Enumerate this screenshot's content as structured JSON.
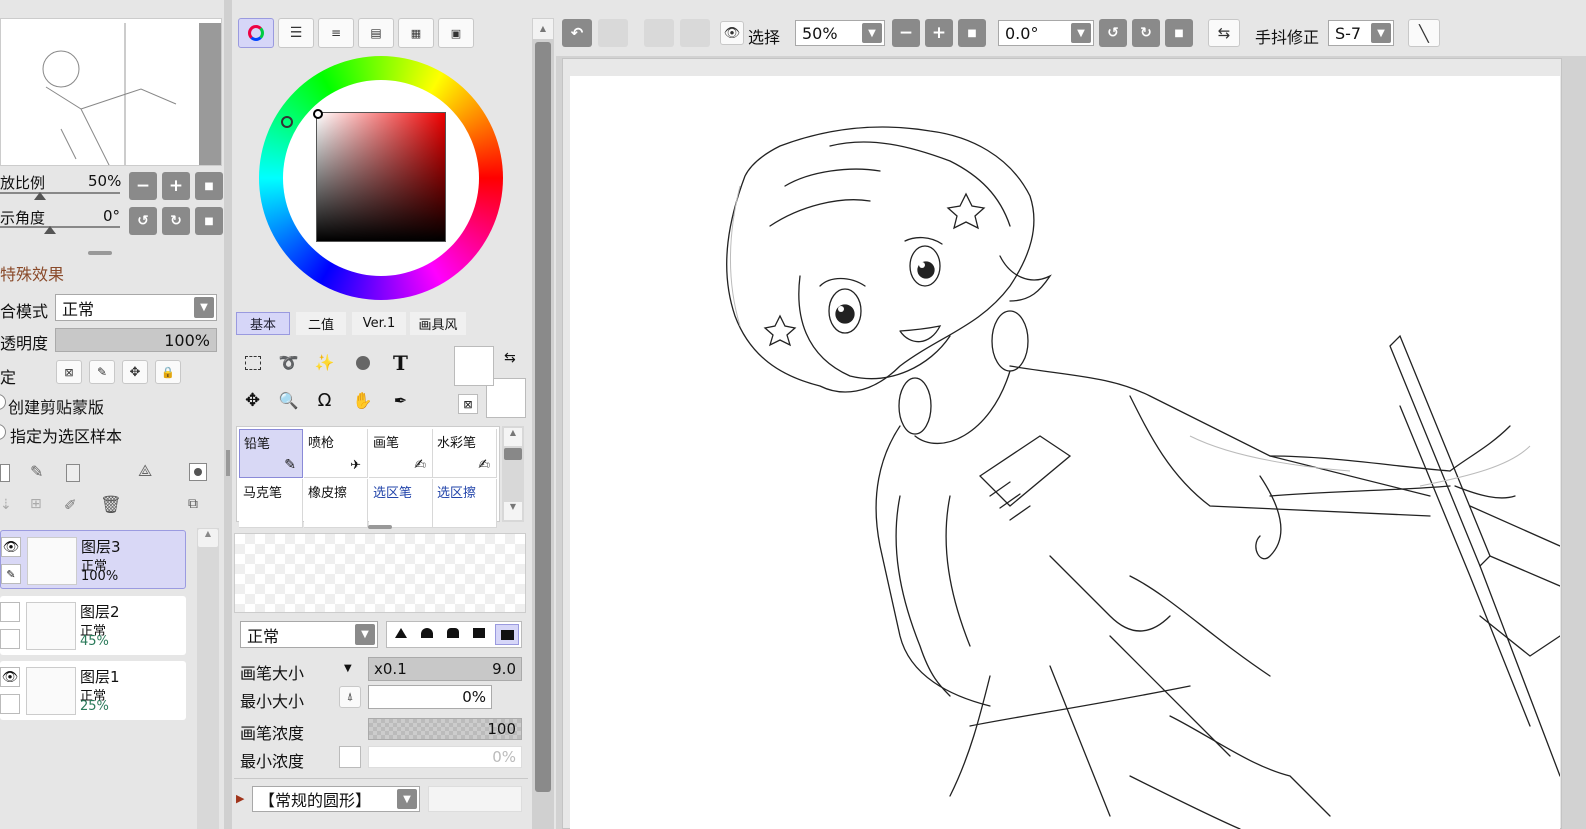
{
  "navigator": {
    "zoom_label": "放比例",
    "zoom_value": "50%",
    "angle_label": "示角度",
    "angle_value": "0°"
  },
  "layer_panel": {
    "effects_label": "特殊效果",
    "blend_label": "合模式",
    "blend_value": "正常",
    "opacity_label": "透明度",
    "opacity_value": "100%",
    "lock_label": "定",
    "clip_label": "创建剪贴蒙版",
    "sample_label": "指定为选区样本",
    "layers": [
      {
        "name": "图层3",
        "mode": "正常",
        "opacity": "100%"
      },
      {
        "name": "图层2",
        "mode": "正常",
        "opacity": "45%"
      },
      {
        "name": "图层1",
        "mode": "正常",
        "opacity": "25%"
      }
    ]
  },
  "color_panel": {
    "tabs": [
      "基本",
      "二值",
      "Ver.1",
      "画具风"
    ],
    "hue_accent": "#ff0000"
  },
  "tools": {
    "text_tool": "T",
    "brushes": [
      {
        "label": "铅笔"
      },
      {
        "label": "喷枪"
      },
      {
        "label": "画笔"
      },
      {
        "label": "水彩笔"
      },
      {
        "label": "马克笔"
      },
      {
        "label": "橡皮擦"
      },
      {
        "label": "选区笔"
      },
      {
        "label": "选区擦"
      }
    ]
  },
  "brush_settings": {
    "blend_value": "正常",
    "size_label": "画笔大小",
    "size_multiplier": "x0.1",
    "size_value": "9.0",
    "min_size_label": "最小大小",
    "min_size_value": "0%",
    "density_label": "画笔浓度",
    "density_value": "100",
    "min_density_label": "最小浓度",
    "min_density_value": "0%",
    "shape_value": "【常规的圆形】"
  },
  "toolbar": {
    "select_label": "选择",
    "zoom_value": "50%",
    "angle_value": "0.0°",
    "stabilizer_label": "手抖修正",
    "stabilizer_value": "S-7"
  }
}
